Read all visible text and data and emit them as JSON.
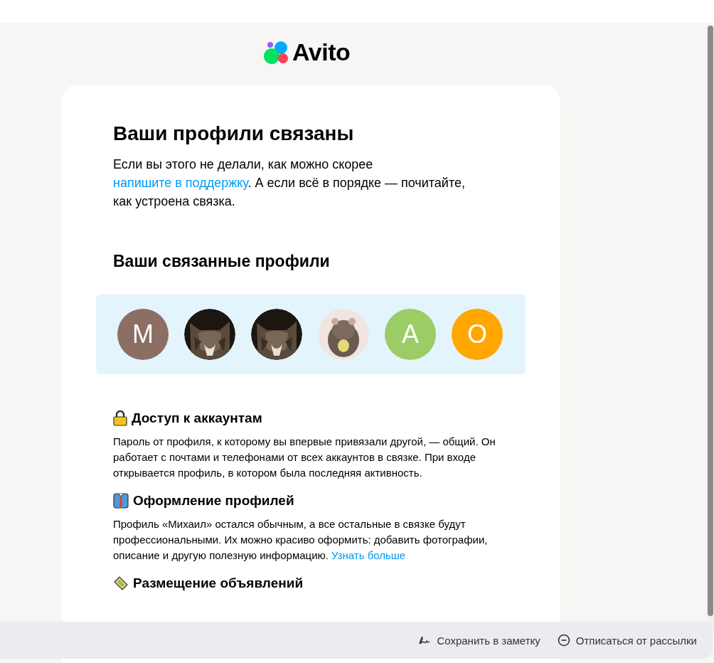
{
  "logo": {
    "text": "Avito"
  },
  "title": "Ваши профили связаны",
  "intro": {
    "before": "Если вы этого не делали, как можно скорее ",
    "link": "напишите в поддержку",
    "after": ". А если всё в порядке — почитайте, как устроена связка."
  },
  "profiles_title": "Ваши связанные профили",
  "avatars": [
    {
      "kind": "letter",
      "letter": "М",
      "color": "#8d6e63"
    },
    {
      "kind": "picture"
    },
    {
      "kind": "picture"
    },
    {
      "kind": "picture"
    },
    {
      "kind": "letter",
      "letter": "А",
      "color": "#9ccc65"
    },
    {
      "kind": "letter",
      "letter": "О",
      "color": "#ffa600"
    }
  ],
  "sections": [
    {
      "kind": "lock",
      "heading": "Доступ к аккаунтам",
      "text": "Пароль от профиля, к которому вы впервые привязали другой, — общий. Он работает с почтами и телефонами от всех аккаунтов в связке. При входе открывается профиль, в котором была последняя активность."
    },
    {
      "kind": "shirt",
      "heading": "Оформление профилей",
      "text": "Профиль «Михаил» остался обычным, а все остальные в связке будут профессиональными. Их можно красиво оформить: добавить фотографии, описание и другую полезную информацию.",
      "link": "Узнать больше"
    },
    {
      "kind": "ticket",
      "heading": "Размещение объявлений"
    }
  ],
  "footer": [
    {
      "kind": "note",
      "label": "Сохранить в заметку"
    },
    {
      "kind": "unsubscribe",
      "label": "Отписаться от рассылки"
    }
  ]
}
